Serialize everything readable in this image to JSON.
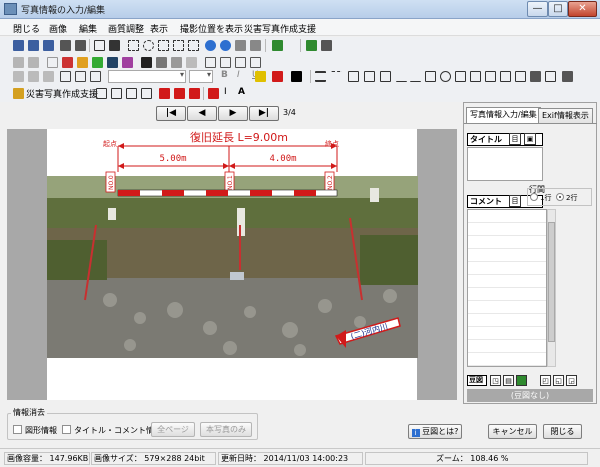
{
  "window": {
    "title": "写真情報の入力/編集",
    "btn_min": "—",
    "btn_max": "□",
    "btn_close": "✕"
  },
  "menu": [
    "閉じる",
    "画像",
    "編集",
    "画質調整",
    "表示",
    "撮影位置を表示",
    "災害写真作成支援"
  ],
  "toolbar4": {
    "label": "災害写真作成支援",
    "text_i": "I",
    "text_a": "A"
  },
  "toolbar3": {
    "bold": "B",
    "italic": "I",
    "underline": "U"
  },
  "nav": {
    "first": "|◀",
    "prev": "◀",
    "next": "▶",
    "last": "▶|",
    "page": "3/4"
  },
  "photo": {
    "title": "復旧延長 L=9.00m",
    "start": "起点",
    "end": "終点",
    "dim1": "5.00m",
    "dim2": "4.00m",
    "no0": "NO.0",
    "no1": "NO.1",
    "no2": "NO.2",
    "river": "(二)河内川"
  },
  "rpanel": {
    "tab1": "写真情報入力/編集",
    "tab2": "Exif情報表示",
    "title_label": "タイトル",
    "comment_label": "コメント",
    "gyokan": "行間",
    "opt1": "1行",
    "opt2": "2行",
    "zumen_label": "豆図",
    "zumen_none": "(豆図なし)"
  },
  "bottom": {
    "group": "情報消去",
    "chk1": "図形情報",
    "chk2": "タイトル・コメント情報",
    "btn_all": "全ページ",
    "btn_this": "本写真のみ",
    "zumen_help": "豆図とは?",
    "cancel": "キャンセル",
    "close": "閉じる"
  },
  "status": {
    "size": "画像容量： 147.96KB",
    "dims": "画像サイズ： 579×288 24bit",
    "date": "更新日時： 2014/11/03 14:00:23",
    "zoom": "ズーム： 108.46 %"
  },
  "colors": {
    "accent": "#d11a1a",
    "frame": "#6f8bb0"
  }
}
